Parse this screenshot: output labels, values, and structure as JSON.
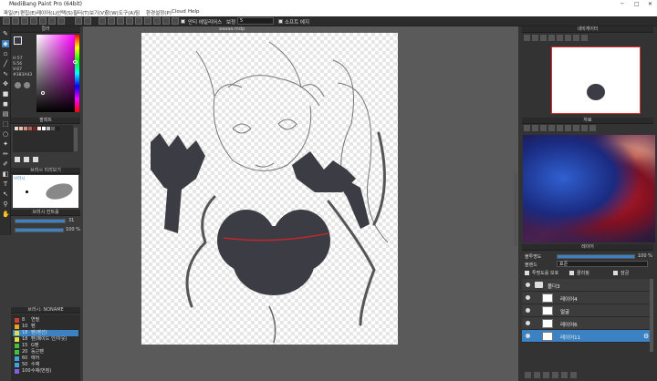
{
  "window": {
    "title": "MediBang Paint Pro (64bit)",
    "controls": [
      "─",
      "□",
      "✕"
    ]
  },
  "menu": [
    "파일(F)",
    "편집(E)",
    "레이어(L)",
    "선택(S)",
    "필터(T)",
    "보기(V)",
    "창(W)",
    "도구(A)",
    "팀",
    "환경설정(P)",
    "Cloud",
    "Help"
  ],
  "toolbar": {
    "antialias_label": "안티 에일리어스",
    "snap_label": "보정",
    "snap_value": "5",
    "softedge_label": "소프트 에지"
  },
  "colorpanel": {
    "title": "컬러",
    "hsv": [
      "H:57",
      "S:56",
      "V:67",
      "#383A43"
    ]
  },
  "palette": {
    "title": "팔레트"
  },
  "brushpreview": {
    "title": "브러시 미리보기",
    "label": "브러시"
  },
  "brushcontrol": {
    "title": "브러시 컨트롤",
    "size": "31",
    "opacity": "100 %"
  },
  "brushlist": {
    "title": "브러시: NONAME",
    "items": [
      {
        "size": "8",
        "name": "연필",
        "color": "#d04030"
      },
      {
        "size": "10",
        "name": "펜",
        "color": "#f0a020"
      },
      {
        "size": "18",
        "name": "펜(펜선)",
        "color": "#e0e040",
        "selected": true
      },
      {
        "size": "18",
        "name": "펜(페이드 인/아웃)",
        "color": "#e0e040"
      },
      {
        "size": "15",
        "name": "G펜",
        "color": "#40c040"
      },
      {
        "size": "20",
        "name": "둥근펜",
        "color": "#40c040"
      },
      {
        "size": "60",
        "name": "에어",
        "color": "#40a0e0"
      },
      {
        "size": "50",
        "name": "수채",
        "color": "#40a0e0"
      },
      {
        "size": "100",
        "name": "수채(번짐)",
        "color": "#8060e0"
      }
    ]
  },
  "canvas": {
    "filename": "aaaaa.mdp"
  },
  "navigator": {
    "title": "내비게이터"
  },
  "reference": {
    "title": "자료"
  },
  "layers": {
    "title": "레이어",
    "blend_label": "블렌드",
    "blend_value": "표준",
    "opacity_label": "불투명도",
    "opacity_value": "100 %",
    "protect_label": "투명도를 보호",
    "clipping_label": "클리핑",
    "lock_label": "잠금",
    "folder": "폴더3",
    "items": [
      {
        "name": "레이어4",
        "selected": false
      },
      {
        "name": "얼굴",
        "selected": false
      },
      {
        "name": "레이어6",
        "selected": false
      },
      {
        "name": "레이어11",
        "selected": true
      }
    ]
  },
  "colors": {
    "accent": "#3b82c4",
    "foreground": "#383A43",
    "background_color": "#ffffff",
    "stroke_red": "#c0282e"
  }
}
